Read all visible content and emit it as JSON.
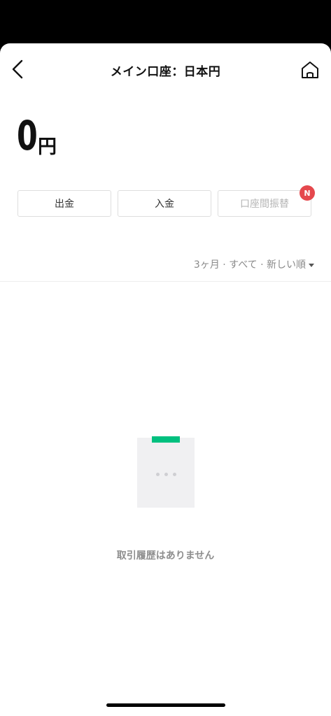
{
  "header": {
    "title": "メイン口座：日本円",
    "back_icon": "chevron-left-icon",
    "home_icon": "home-icon"
  },
  "balance": {
    "amount": "0",
    "currency": "円"
  },
  "actions": [
    {
      "label": "出金",
      "enabled": true
    },
    {
      "label": "入金",
      "enabled": true
    },
    {
      "label": "口座間振替",
      "enabled": false,
      "badge": "N"
    }
  ],
  "filter": {
    "label": "3ヶ月 · すべて · 新しい順"
  },
  "empty_state": {
    "message": "取引履歴はありません"
  },
  "colors": {
    "accent": "#00c07f",
    "badge": "#e5484d"
  }
}
